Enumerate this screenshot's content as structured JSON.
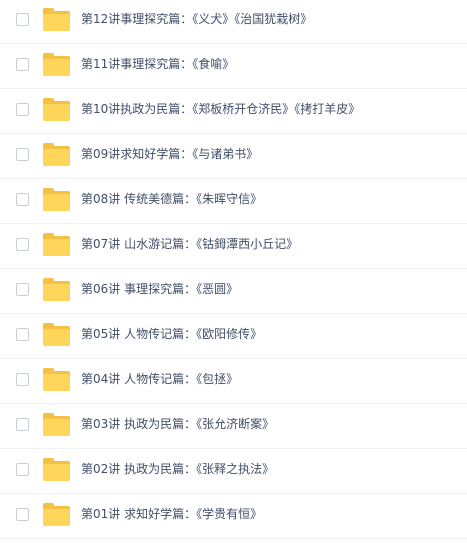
{
  "files": [
    {
      "name": "第12讲事理探究篇：《义犬》《治国犹栽树》"
    },
    {
      "name": "第11讲事理探究篇：《食喻》"
    },
    {
      "name": "第10讲执政为民篇：《郑板桥开仓济民》《拷打羊皮》"
    },
    {
      "name": "第09讲求知好学篇：《与诸弟书》"
    },
    {
      "name": "第08讲 传统美德篇：《朱晖守信》"
    },
    {
      "name": "第07讲 山水游记篇：《钴鉧潭西小丘记》"
    },
    {
      "name": "第06讲 事理探究篇：《恶圆》"
    },
    {
      "name": "第05讲 人物传记篇：《欧阳修传》"
    },
    {
      "name": "第04讲 人物传记篇：《包拯》"
    },
    {
      "name": "第03讲 执政为民篇：《张允济断案》"
    },
    {
      "name": "第02讲 执政为民篇：《张释之执法》"
    },
    {
      "name": "第01讲 求知好学篇：《学贵有恒》"
    }
  ]
}
